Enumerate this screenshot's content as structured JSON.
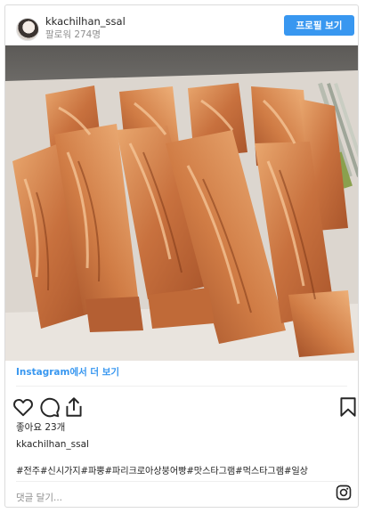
{
  "header": {
    "username": "kkachilhan_ssal",
    "followers": "팔로워 274명",
    "profile_button": "프로필 보기"
  },
  "photo": {
    "subject": "pastry-photo"
  },
  "links": {
    "view_more": "Instagram에서 더 보기"
  },
  "actions": {
    "icons": [
      "heart-icon",
      "comment-icon",
      "share-icon",
      "bookmark-icon"
    ]
  },
  "post": {
    "likes": "좋아요 23개",
    "caption_user": "kkachilhan_ssal",
    "hashtags": "#전주#신시가지#파뿡#파리크로아상붕어빵#맛스타그램#먹스타그램#일상"
  },
  "comment": {
    "placeholder": "댓글 달기..."
  },
  "colors": {
    "accent": "#3897f0",
    "border": "#dbdbdb",
    "text": "#262626",
    "muted": "#8e8e8e"
  }
}
